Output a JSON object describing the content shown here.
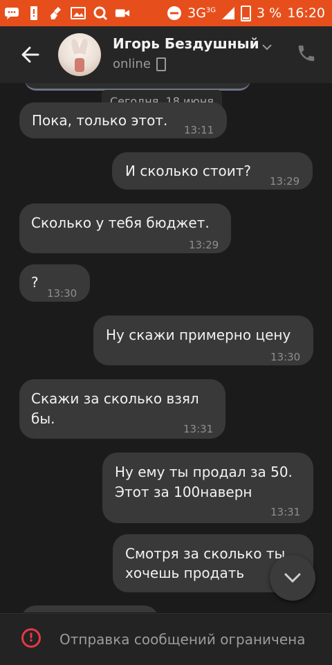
{
  "status_bar": {
    "network": "3G",
    "network_sup": "3G",
    "battery": "3 %",
    "time": "16:20",
    "icons": [
      "chat-icon",
      "alert-icon",
      "cleaner-icon",
      "gallery-icon",
      "search-app-icon",
      "video-icon",
      "dnd-icon",
      "battery-icon"
    ]
  },
  "header": {
    "contact_name": "Игорь Бездушный",
    "status": "online",
    "icons": [
      "back-arrow-icon",
      "chevron-down-icon",
      "phone-device-icon",
      "call-icon"
    ]
  },
  "chat": {
    "date_separator": "Сегодня, 18 июня",
    "messages": [
      {
        "side": "in",
        "text": "Пока, только этот.",
        "time": "13:11"
      },
      {
        "side": "out",
        "text": "И сколько стоит?",
        "time": "13:29"
      },
      {
        "side": "in",
        "text": "Сколько у тебя бюджет.",
        "time": "13:29"
      },
      {
        "side": "in",
        "text": "?",
        "time": "13:30"
      },
      {
        "side": "out",
        "text": "Ну скажи примерно цену",
        "time": "13:30"
      },
      {
        "side": "in",
        "lines": [
          "Скажи за сколько взял",
          "бы."
        ],
        "time": "13:31"
      },
      {
        "side": "out",
        "lines": [
          "Ну ему ты продал за 50.",
          "Этот за 100наверн"
        ],
        "time": "13:31"
      },
      {
        "side": "out",
        "lines": [
          "Смотря за сколько ты",
          "хочешь продать"
        ],
        "time": ""
      }
    ]
  },
  "bottom_bar": {
    "text": "Отправка сообщений ограничена",
    "icon": "warning-icon",
    "accent_color": "#e53945"
  },
  "colors": {
    "status_bar": "#e64f1c",
    "background": "#1b1b1b",
    "header": "#262626",
    "bubble": "#393939"
  }
}
